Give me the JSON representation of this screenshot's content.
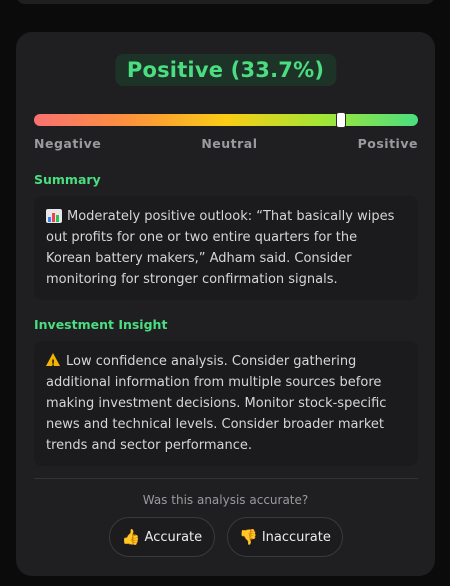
{
  "sentiment": {
    "label": "Positive (33.7%)",
    "score_fraction": 0.8,
    "color": "#4ade80"
  },
  "gauge": {
    "left_label": "Negative",
    "mid_label": "Neutral",
    "right_label": "Positive"
  },
  "summary": {
    "title": "Summary",
    "icon": "bar-chart-icon",
    "text": "Moderately positive outlook: “That basically wipes out profits for one or two entire quarters for the Korean battery makers,” Adham said. Consider monitoring for stronger confirmation signals."
  },
  "insight": {
    "title": "Investment Insight",
    "icon": "warning-icon",
    "text": "Low confidence analysis. Consider gathering additional information from multiple sources before making investment decisions. Monitor stock-specific news and technical levels. Consider broader market trends and sector performance."
  },
  "feedback": {
    "question": "Was this analysis accurate?",
    "accurate_label": "Accurate",
    "accurate_icon": "thumbs-up-icon",
    "inaccurate_label": "Inaccurate",
    "inaccurate_icon": "thumbs-down-icon"
  }
}
